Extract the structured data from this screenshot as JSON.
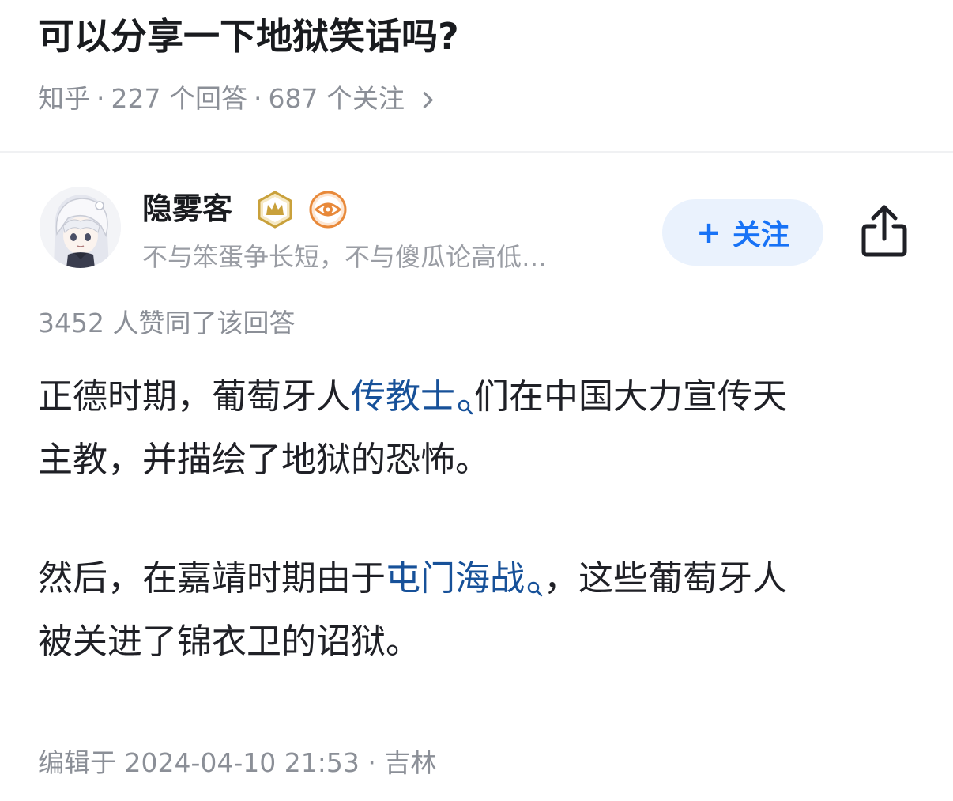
{
  "question": {
    "title": "可以分享一下地狱笑话吗?",
    "source": "知乎",
    "answers": "227 个回答",
    "followers": "687 个关注",
    "sep": "·"
  },
  "author": {
    "name": "隐雾客",
    "bio": "不与笨蛋争长短，不与傻瓜论高低…",
    "badges": [
      "crown-badge-icon",
      "eye-badge-icon"
    ]
  },
  "actions": {
    "follow_plus": "+",
    "follow_label": "关注",
    "share_icon": "share-icon"
  },
  "answer": {
    "vote_count": "3452 人赞同了该回答",
    "para1_line1_pre": "正德时期，葡萄牙人",
    "para1_link": "传教士",
    "para1_line1_post": "们在中国大力宣传天",
    "para1_line2": "主教，并描绘了地狱的恐怖。",
    "para2_line1_pre": "然后，在嘉靖时期由于",
    "para2_link": "屯门海战",
    "para2_line1_post": "，这些葡萄牙人",
    "para2_line2": "被关进了锦衣卫的诏狱。",
    "edit_info": "编辑于 2024-04-10 21:53 · 吉林"
  },
  "colors": {
    "link": "#175199",
    "accent": "#1772f6",
    "meta": "#8b8f97",
    "badge_gold": "#c9a13b",
    "badge_orange": "#e8893a"
  }
}
